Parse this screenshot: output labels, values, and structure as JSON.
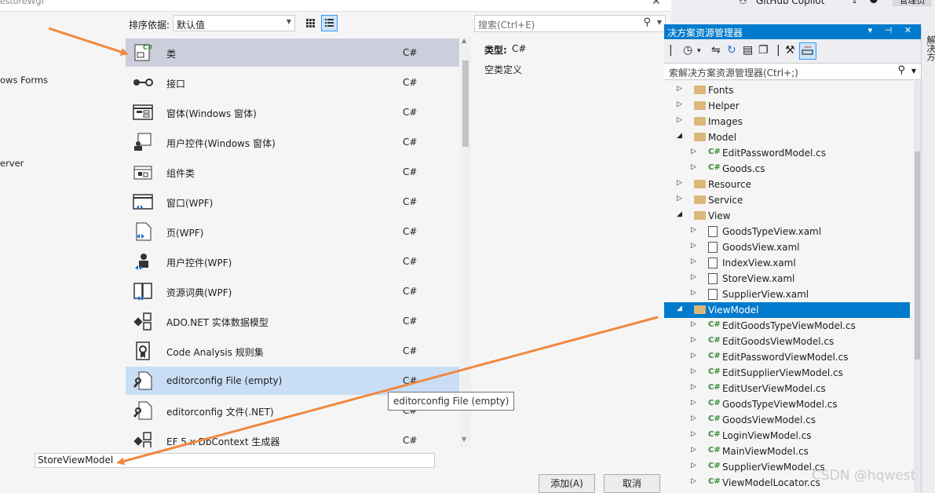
{
  "dialog": {
    "title": "estoreWgr",
    "categories": [
      "ows Forms",
      "erver"
    ],
    "sort_label": "排序依据:",
    "sort_value": "默认值",
    "search_placeholder": "搜索(Ctrl+E)",
    "templates": [
      {
        "name": "类",
        "lang": "C#",
        "icon": "class-icon",
        "state": "selected"
      },
      {
        "name": "接口",
        "lang": "C#",
        "icon": "interface-icon"
      },
      {
        "name": "窗体(Windows 窗体)",
        "lang": "C#",
        "icon": "windows-form-icon"
      },
      {
        "name": "用户控件(Windows 窗体)",
        "lang": "C#",
        "icon": "user-control-icon"
      },
      {
        "name": "组件类",
        "lang": "C#",
        "icon": "component-class-icon"
      },
      {
        "name": "窗口(WPF)",
        "lang": "C#",
        "icon": "wpf-window-icon"
      },
      {
        "name": "页(WPF)",
        "lang": "C#",
        "icon": "wpf-page-icon"
      },
      {
        "name": "用户控件(WPF)",
        "lang": "C#",
        "icon": "wpf-user-control-icon"
      },
      {
        "name": "资源词典(WPF)",
        "lang": "C#",
        "icon": "resource-dictionary-icon"
      },
      {
        "name": "ADO.NET 实体数据模型",
        "lang": "C#",
        "icon": "entity-model-icon"
      },
      {
        "name": "Code Analysis 规则集",
        "lang": "C#",
        "icon": "ruleset-icon"
      },
      {
        "name": "editorconfig File (empty)",
        "lang": "C#",
        "icon": "editorconfig-icon",
        "state": "hover"
      },
      {
        "name": "editorconfig 文件(.NET)",
        "lang": "C#",
        "icon": "editorconfig-icon"
      },
      {
        "name": "EF 5.x DbContext 生成器",
        "lang": "C#",
        "icon": "dbcontext-icon"
      }
    ],
    "detail": {
      "type_label": "类型:",
      "type_value": "C#",
      "description": "空类定义"
    },
    "tooltip": "editorconfig File (empty)",
    "name_value": "StoreViewModel",
    "add_button": "添加(A)",
    "cancel_button": "取消"
  },
  "top": {
    "copilot": "GitHub Copilot",
    "admin": "管理员"
  },
  "solution_explorer": {
    "title": "决方案资源管理器",
    "title_buttons": "▾ ⊣ ✕",
    "search_placeholder": "索解决方案资源管理器(Ctrl+;)",
    "side_tab": "解决方",
    "tree": [
      {
        "label": "Fonts",
        "kind": "folder",
        "depth": 0,
        "expander": "▷"
      },
      {
        "label": "Helper",
        "kind": "folder",
        "depth": 0,
        "expander": "▷"
      },
      {
        "label": "Images",
        "kind": "folder",
        "depth": 0,
        "expander": "▷"
      },
      {
        "label": "Model",
        "kind": "folder",
        "depth": 0,
        "expander": "◢"
      },
      {
        "label": "EditPasswordModel.cs",
        "kind": "cs",
        "depth": 1,
        "expander": "▷"
      },
      {
        "label": "Goods.cs",
        "kind": "cs",
        "depth": 1,
        "expander": "▷"
      },
      {
        "label": "Resource",
        "kind": "folder",
        "depth": 0,
        "expander": "▷"
      },
      {
        "label": "Service",
        "kind": "folder",
        "depth": 0,
        "expander": "▷"
      },
      {
        "label": "View",
        "kind": "folder",
        "depth": 0,
        "expander": "◢"
      },
      {
        "label": "GoodsTypeView.xaml",
        "kind": "xaml",
        "depth": 1,
        "expander": "▷"
      },
      {
        "label": "GoodsView.xaml",
        "kind": "xaml",
        "depth": 1,
        "expander": "▷"
      },
      {
        "label": "IndexView.xaml",
        "kind": "xaml",
        "depth": 1,
        "expander": "▷"
      },
      {
        "label": "StoreView.xaml",
        "kind": "xaml",
        "depth": 1,
        "expander": "▷"
      },
      {
        "label": "SupplierView.xaml",
        "kind": "xaml",
        "depth": 1,
        "expander": "▷"
      },
      {
        "label": "ViewModel",
        "kind": "folder",
        "depth": 0,
        "expander": "◢",
        "state": "selected"
      },
      {
        "label": "EditGoodsTypeViewModel.cs",
        "kind": "cs",
        "depth": 1,
        "expander": "▷"
      },
      {
        "label": "EditGoodsViewModel.cs",
        "kind": "cs",
        "depth": 1,
        "expander": "▷"
      },
      {
        "label": "EditPasswordViewModel.cs",
        "kind": "cs",
        "depth": 1,
        "expander": "▷"
      },
      {
        "label": "EditSupplierViewModel.cs",
        "kind": "cs",
        "depth": 1,
        "expander": "▷"
      },
      {
        "label": "EditUserViewModel.cs",
        "kind": "cs",
        "depth": 1,
        "expander": "▷"
      },
      {
        "label": "GoodsTypeViewModel.cs",
        "kind": "cs",
        "depth": 1,
        "expander": "▷"
      },
      {
        "label": "GoodsViewModel.cs",
        "kind": "cs",
        "depth": 1,
        "expander": "▷"
      },
      {
        "label": "LoginViewModel.cs",
        "kind": "cs",
        "depth": 1,
        "expander": "▷"
      },
      {
        "label": "MainViewModel.cs",
        "kind": "cs",
        "depth": 1,
        "expander": "▷"
      },
      {
        "label": "SupplierViewModel.cs",
        "kind": "cs",
        "depth": 1,
        "expander": "▷"
      },
      {
        "label": "ViewModelLocator.cs",
        "kind": "cs",
        "depth": 1,
        "expander": "▷"
      }
    ]
  },
  "cs_badge": "C#",
  "watermark": "CSDN @hqwest",
  "colors": {
    "accent": "#007acc",
    "arrow": "#f0883e",
    "selection": "#cccedb",
    "hover": "#c9def5"
  }
}
